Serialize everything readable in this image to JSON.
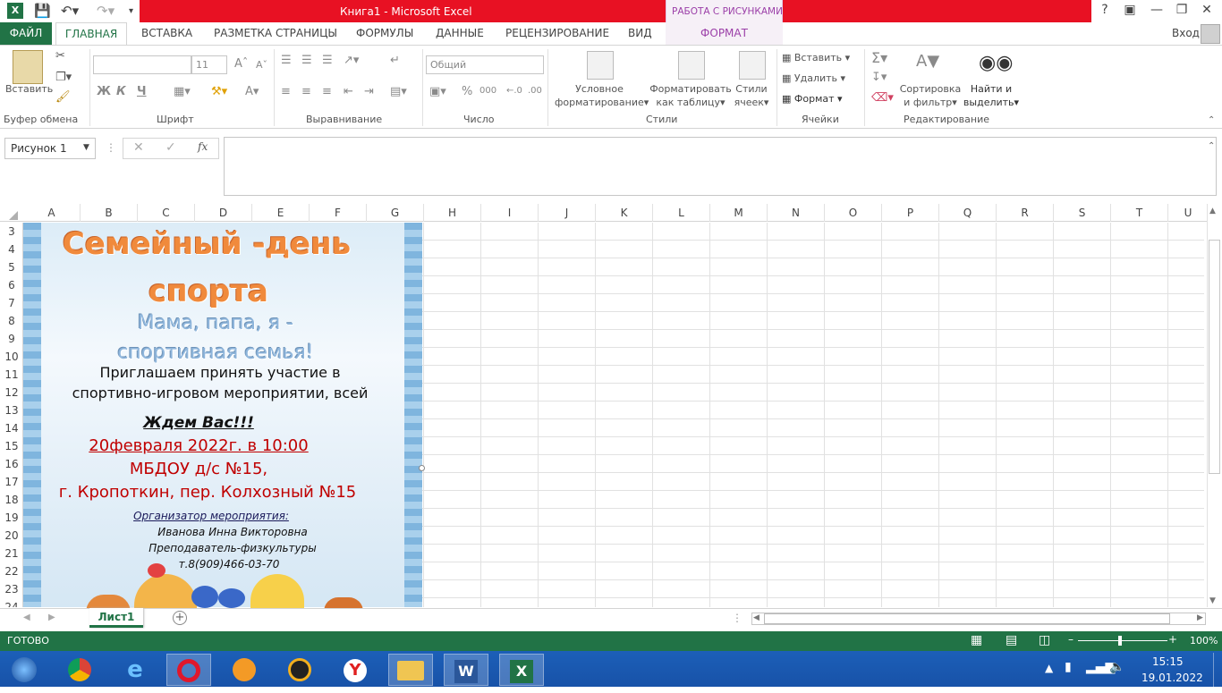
{
  "window": {
    "title": "Книга1 -  Microsoft Excel",
    "context_group": "РАБОТА С РИСУНКАМИ",
    "sign_in": "Вход",
    "help": "?"
  },
  "tabs": [
    "ФАЙЛ",
    "ГЛАВНАЯ",
    "ВСТАВКА",
    "РАЗМЕТКА СТРАНИЦЫ",
    "ФОРМУЛЫ",
    "ДАННЫЕ",
    "РЕЦЕНЗИРОВАНИЕ",
    "ВИД",
    "ФОРМАТ"
  ],
  "ribbon": {
    "clipboard": {
      "paste": "Вставить",
      "group": "Буфер обмена"
    },
    "font": {
      "size": "11",
      "bold": "Ж",
      "italic": "К",
      "underline": "Ч",
      "group": "Шрифт"
    },
    "alignment": {
      "group": "Выравнивание"
    },
    "number": {
      "format": "Общий",
      "group": "Число"
    },
    "styles": {
      "conditional_1": "Условное",
      "conditional_2": "форматирование",
      "table_1": "Форматировать",
      "table_2": "как таблицу",
      "cell_1": "Стили",
      "cell_2": "ячеек",
      "group": "Стили"
    },
    "cells": {
      "insert": "Вставить",
      "delete": "Удалить",
      "format": "Формат",
      "group": "Ячейки"
    },
    "editing": {
      "sort_1": "Сортировка",
      "sort_2": "и фильтр",
      "find_1": "Найти и",
      "find_2": "выделить",
      "group": "Редактирование"
    }
  },
  "formula_bar": {
    "name_box": "Рисунок 1",
    "fx": "fx",
    "value": ""
  },
  "columns": [
    "A",
    "B",
    "C",
    "D",
    "E",
    "F",
    "G",
    "H",
    "I",
    "J",
    "K",
    "L",
    "M",
    "N",
    "O",
    "P",
    "Q",
    "R",
    "S",
    "T",
    "U"
  ],
  "rows": [
    "3",
    "4",
    "5",
    "6",
    "7",
    "8",
    "9",
    "10",
    "11",
    "12",
    "13",
    "14",
    "15",
    "16",
    "17",
    "18",
    "19",
    "20",
    "21",
    "22",
    "23",
    "24"
  ],
  "poster": {
    "title_1": "Семейный -день",
    "title_2": "спорта",
    "subtitle_1": "Мама, папа, я -",
    "subtitle_2": "спортивная семья!",
    "invite_1": "Приглашаем принять участие в",
    "invite_2": "спортивно-игровом мероприятии, всей",
    "wait": "Ждем Вас!!!",
    "date": "20февраля 2022г. в 10:00",
    "place_1": "МБДОУ д/с №15,",
    "place_2": "г. Кропоткин,  пер. Колхозный №15",
    "org_label": "Организатор мероприятия:",
    "org_name": "Иванова Инна Викторовна",
    "org_role": "Преподаватель-физкультуры",
    "org_phone": "т.8(909)466-03-70",
    "colors": {
      "title": "#f08a3c",
      "subtitle": "#8fb6dc",
      "red": "#c00000",
      "border": "#7fb5de"
    }
  },
  "sheet_tabs": [
    "Лист1"
  ],
  "status": {
    "ready": "ГОТОВО",
    "zoom": "100%"
  },
  "taskbar": {
    "apps": [
      "windows-start",
      "chrome",
      "internet-explorer",
      "opera",
      "settings-app",
      "aimp",
      "yandex-browser",
      "file-explorer",
      "word",
      "excel"
    ],
    "time": "15:15",
    "date": "19.01.2022"
  }
}
